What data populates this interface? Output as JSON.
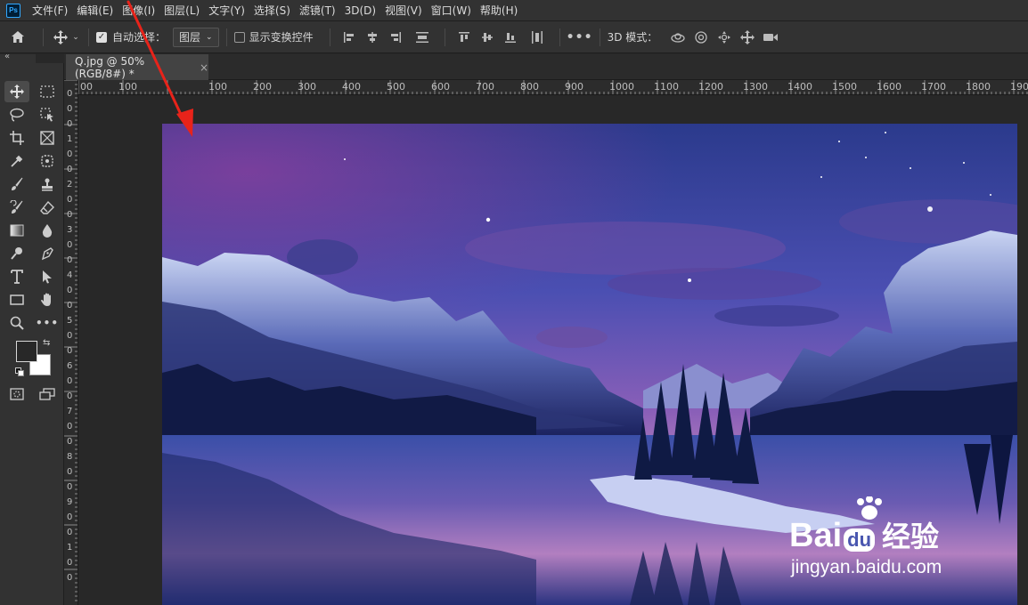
{
  "app": {
    "logo": "Ps"
  },
  "menu": [
    "文件(F)",
    "编辑(E)",
    "图像(I)",
    "图层(L)",
    "文字(Y)",
    "选择(S)",
    "滤镜(T)",
    "3D(D)",
    "视图(V)",
    "窗口(W)",
    "帮助(H)"
  ],
  "options": {
    "auto_select_label": "自动选择：",
    "auto_select_checked": true,
    "auto_select_target": "图层",
    "show_transform_label": "显示变换控件",
    "show_transform_checked": false,
    "mode_3d_label": "3D 模式："
  },
  "document": {
    "tab_title": "Q.jpg @ 50%(RGB/8#) *",
    "close_glyph": "×"
  },
  "ruler": {
    "h_labels": [
      "00",
      "100",
      "100",
      "200",
      "300",
      "400",
      "500",
      "600",
      "700",
      "800",
      "900",
      "1000",
      "1100",
      "1200",
      "1300",
      "1400",
      "1500",
      "1600",
      "1700",
      "1800",
      "190"
    ],
    "v_labels": [
      "0",
      "0",
      "0",
      "1",
      "0",
      "0",
      "2",
      "0",
      "0",
      "3",
      "0",
      "0",
      "4",
      "0",
      "0",
      "5",
      "0",
      "0",
      "6",
      "0",
      "0",
      "7",
      "0",
      "0",
      "8",
      "0",
      "0",
      "9",
      "0",
      "0",
      "1",
      "0",
      "0"
    ]
  },
  "watermark": {
    "brand_prefix": "Bai",
    "brand_suffix": "经验",
    "url": "jingyan.baidu.com"
  },
  "colors": {
    "accent_ps": "#31a8ff",
    "arrow": "#e8231a",
    "chrome": "#323232"
  }
}
